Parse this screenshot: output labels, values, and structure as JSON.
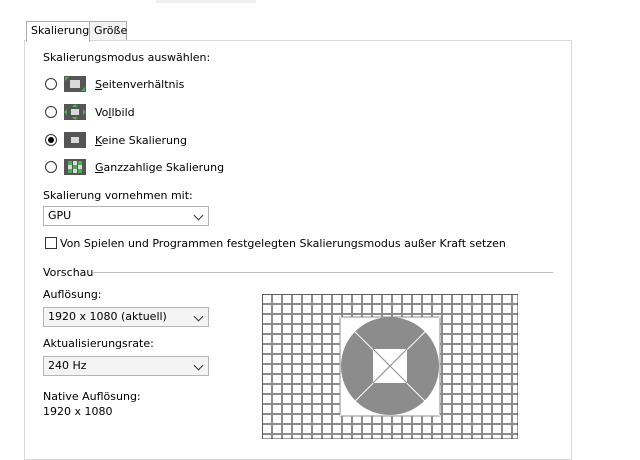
{
  "tabs": [
    {
      "label": "Skalierung"
    },
    {
      "label": "Größe"
    }
  ],
  "scaling_mode": {
    "heading": "Skalierungsmodus auswählen:",
    "options": [
      {
        "hot": "S",
        "rest": "eitenverhältnis",
        "icon": "aspect-ratio-icon",
        "checked": false
      },
      {
        "hot": "V",
        "rest": "ollbild",
        "pre": "",
        "icon": "fullscreen-icon",
        "checked": false
      },
      {
        "hot": "K",
        "rest": "eine Skalierung",
        "icon": "no-scaling-icon",
        "checked": true
      },
      {
        "hot": "G",
        "rest": "anzzahlige Skalierung",
        "icon": "integer-scaling-icon",
        "checked": false
      }
    ]
  },
  "perform_scaling": {
    "label": "Skalierung vornehmen mit:",
    "value": "GPU"
  },
  "override": {
    "label": "Von Spielen und Programmen festgelegten Skalierungsmodus außer Kraft setzen",
    "checked": false
  },
  "preview": {
    "heading": "Vorschau",
    "resolution_label": "Auflösung:",
    "resolution_value": "1920 x 1080 (aktuell)",
    "refresh_label": "Aktualisierungsrate:",
    "refresh_value": "240 Hz",
    "native_label": "Native Auflösung:",
    "native_value": "1920 x 1080"
  },
  "colors": {
    "preview_bg": "#8c8c8c",
    "preview_grid": "#ffffff",
    "icon_bg": "#555555",
    "icon_accent": "#4caf50"
  }
}
